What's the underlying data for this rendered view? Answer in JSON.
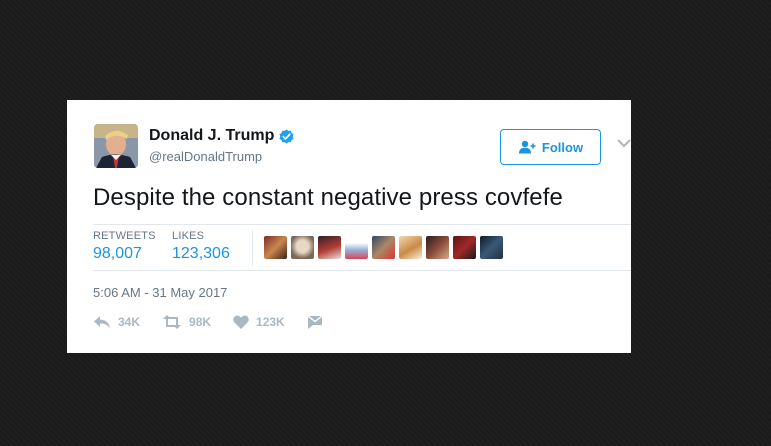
{
  "colors": {
    "accent": "#1b95e0",
    "text": "#14171a",
    "muted": "#657786",
    "icon_gray": "#aab8c2"
  },
  "tweet": {
    "author_name": "Donald J. Trump",
    "author_handle": "@realDonaldTrump",
    "verified_icon": "verified-badge-icon",
    "follow_label": "Follow",
    "text": "Despite the constant negative press covfefe",
    "stats": {
      "retweets_label": "RETWEETS",
      "retweets_value": "98,007",
      "likes_label": "LIKES",
      "likes_value": "123,306"
    },
    "liker_avatar_count": 9,
    "timestamp": "5:06 AM - 31 May 2017",
    "actions": {
      "reply_icon": "reply-icon",
      "reply_count": "34K",
      "retweet_icon": "retweet-icon",
      "retweet_count": "98K",
      "like_icon": "heart-icon",
      "like_count": "123K",
      "dm_icon": "direct-message-icon"
    }
  }
}
